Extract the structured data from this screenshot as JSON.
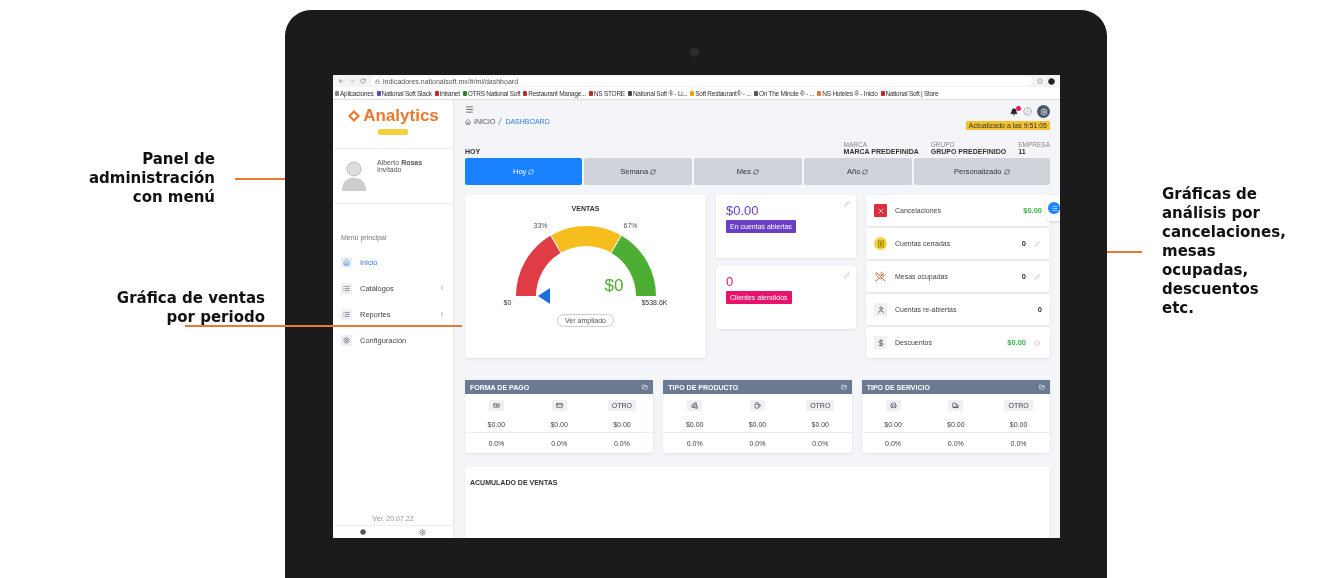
{
  "annotations": {
    "left": [
      {
        "text": "Panel de administración con menú"
      },
      {
        "text": "Gráfica de ventas por periodo"
      }
    ],
    "right": [
      {
        "text": "Gráficas de análisis por cancelaciones, mesas ocupadas, descuentos etc."
      }
    ]
  },
  "browser": {
    "url": "indicadores.nationalsoft.mx/#/mi/dashboard",
    "bookmarks": [
      "Aplicaciones",
      "National Soft Slack",
      "Intranet",
      "OTRS National Soft",
      "Restaurant Manage...",
      "NS STORE",
      "National Soft ® - Li...",
      "Soft Restaurant® - ...",
      "On The Minute ® - ...",
      "NS Hoteles ® - Inicio",
      "National Soft | Store"
    ]
  },
  "sidebar": {
    "logo": "Analytics",
    "user": {
      "first": "Alberto",
      "last": "Rosas",
      "role": "Invitado"
    },
    "menu_title": "Menú principal",
    "items": [
      {
        "label": "Inicio",
        "selected": true,
        "submenu": false
      },
      {
        "label": "Catálogos",
        "selected": false,
        "submenu": true
      },
      {
        "label": "Reportes",
        "selected": false,
        "submenu": true
      },
      {
        "label": "Configuración",
        "selected": false,
        "submenu": false
      }
    ],
    "version": "Ver. 20.07.22"
  },
  "header": {
    "breadcrumb": [
      "INICIO",
      "DASHBOARD"
    ],
    "updated": "Actualizado a las 9:51:05",
    "period": "HOY",
    "filters": [
      {
        "label": "MARCA",
        "value": "MARCA PREDEFINIDA"
      },
      {
        "label": "GRUPO",
        "value": "GRUPO PREDEFINIDO"
      },
      {
        "label": "EMPRESA",
        "value": "11"
      }
    ]
  },
  "tabs": [
    {
      "label": "Hoy",
      "selected": true
    },
    {
      "label": "Semana",
      "selected": false
    },
    {
      "label": "Mes",
      "selected": false
    },
    {
      "label": "Año",
      "selected": false
    },
    {
      "label": "Personalizado",
      "selected": false
    }
  ],
  "gauge": {
    "title": "VENTAS",
    "ticks": [
      "33%",
      "67%"
    ],
    "min": "$0",
    "max": "$538.6K",
    "value": "$0",
    "button": "Ver ampliado"
  },
  "summary": [
    {
      "value": "$0.00",
      "label": "En cuentas abiertas",
      "color": "#6a3fc4"
    },
    {
      "value": "0",
      "label": "Clientes atendidos",
      "color": "#e8146c"
    }
  ],
  "indicators": [
    {
      "kind": "cancel",
      "label": "Cancelaciones",
      "value": "$0.00",
      "highlight": true,
      "edit_icon": false,
      "info_icon": false
    },
    {
      "kind": "receipt",
      "label": "Cuentas cerradas",
      "value": "0",
      "highlight": false,
      "edit_icon": true,
      "info_icon": false
    },
    {
      "kind": "dish",
      "label": "Mesas ocupadas",
      "value": "0",
      "highlight": false,
      "edit_icon": true,
      "info_icon": false
    },
    {
      "kind": "person",
      "label": "Cuentas re-abiertas",
      "value": "0",
      "highlight": false,
      "edit_icon": false,
      "info_icon": false
    },
    {
      "kind": "dollar",
      "label": "Descuentos",
      "value": "$0.00",
      "highlight": true,
      "edit_icon": false,
      "info_icon": true
    }
  ],
  "tables": [
    {
      "title": "FORMA DE PAGO",
      "columns": [
        {
          "kind": "cash"
        },
        {
          "kind": "card"
        },
        {
          "kind": "label",
          "label": "OTRO"
        }
      ],
      "amounts": [
        "$0.00",
        "$0.00",
        "$0.00"
      ],
      "percents": [
        "0.0%",
        "0.0%",
        "0.0%"
      ]
    },
    {
      "title": "TIPO DE PRODUCTO",
      "columns": [
        {
          "kind": "food"
        },
        {
          "kind": "drink"
        },
        {
          "kind": "label",
          "label": "OTRO"
        }
      ],
      "amounts": [
        "$0.00",
        "$0.00",
        "$0.00"
      ],
      "percents": [
        "0.0%",
        "0.0%",
        "0.0%"
      ]
    },
    {
      "title": "TIPO DE SERVICIO",
      "columns": [
        {
          "kind": "table"
        },
        {
          "kind": "delivery"
        },
        {
          "kind": "label",
          "label": "OTRO"
        }
      ],
      "amounts": [
        "$0.00",
        "$0.00",
        "$0.00"
      ],
      "percents": [
        "0.0%",
        "0.0%",
        "0.0%"
      ]
    }
  ],
  "accumulated_title": "ACUMULADO DE VENTAS"
}
